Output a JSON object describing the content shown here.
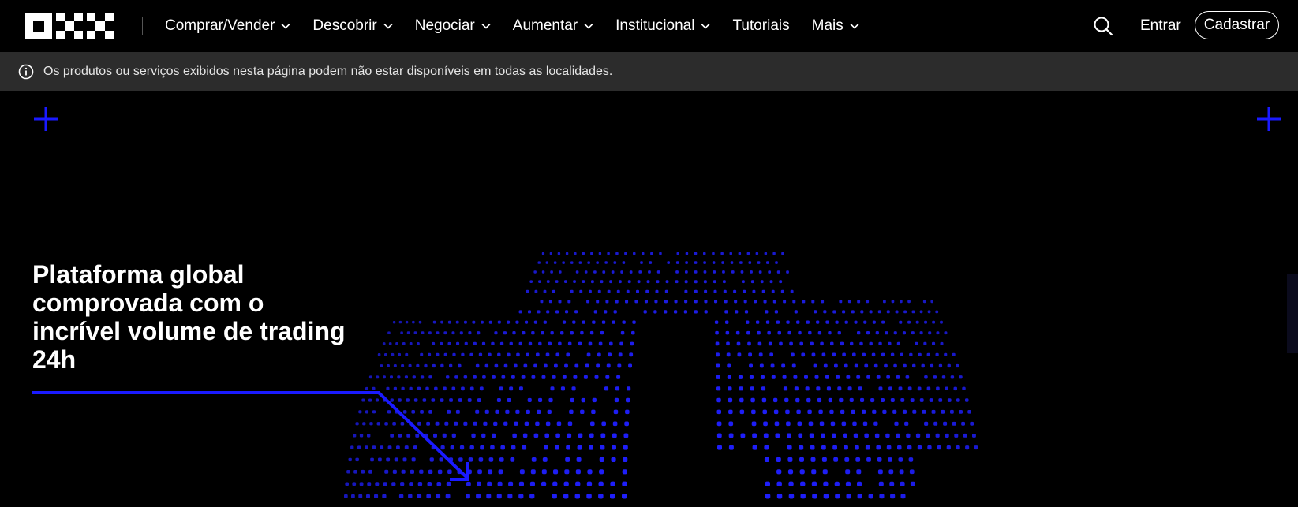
{
  "brand": {
    "name": "OKX"
  },
  "nav": {
    "items": [
      {
        "label": "Comprar/Vender",
        "has_dropdown": true
      },
      {
        "label": "Descobrir",
        "has_dropdown": true
      },
      {
        "label": "Negociar",
        "has_dropdown": true
      },
      {
        "label": "Aumentar",
        "has_dropdown": true
      },
      {
        "label": "Institucional",
        "has_dropdown": true
      },
      {
        "label": "Tutoriais",
        "has_dropdown": false
      },
      {
        "label": "Mais",
        "has_dropdown": true
      }
    ],
    "search_icon": "search-icon",
    "login_label": "Entrar",
    "signup_label": "Cadastrar"
  },
  "notice": {
    "icon": "info-icon",
    "text": "Os produtos ou serviços exibidos nesta página podem não estar disponíveis em todas as localidades."
  },
  "hero": {
    "headline_lines": [
      "Plataforma global",
      "comprovada com o",
      "incrível volume de trading",
      "24h"
    ]
  },
  "colors": {
    "background": "#000000",
    "notice_bg": "#2c2c2c",
    "accent_blue": "#1a1aff",
    "text": "#ffffff"
  }
}
